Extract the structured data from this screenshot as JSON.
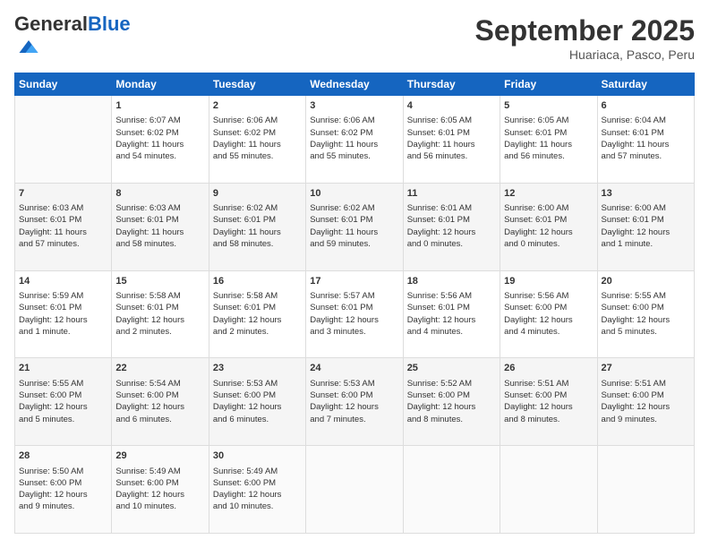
{
  "header": {
    "logo_general": "General",
    "logo_blue": "Blue",
    "month_title": "September 2025",
    "subtitle": "Huariaca, Pasco, Peru"
  },
  "days_of_week": [
    "Sunday",
    "Monday",
    "Tuesday",
    "Wednesday",
    "Thursday",
    "Friday",
    "Saturday"
  ],
  "weeks": [
    [
      {
        "day": "",
        "content": ""
      },
      {
        "day": "1",
        "content": "Sunrise: 6:07 AM\nSunset: 6:02 PM\nDaylight: 11 hours\nand 54 minutes."
      },
      {
        "day": "2",
        "content": "Sunrise: 6:06 AM\nSunset: 6:02 PM\nDaylight: 11 hours\nand 55 minutes."
      },
      {
        "day": "3",
        "content": "Sunrise: 6:06 AM\nSunset: 6:02 PM\nDaylight: 11 hours\nand 55 minutes."
      },
      {
        "day": "4",
        "content": "Sunrise: 6:05 AM\nSunset: 6:01 PM\nDaylight: 11 hours\nand 56 minutes."
      },
      {
        "day": "5",
        "content": "Sunrise: 6:05 AM\nSunset: 6:01 PM\nDaylight: 11 hours\nand 56 minutes."
      },
      {
        "day": "6",
        "content": "Sunrise: 6:04 AM\nSunset: 6:01 PM\nDaylight: 11 hours\nand 57 minutes."
      }
    ],
    [
      {
        "day": "7",
        "content": "Sunrise: 6:03 AM\nSunset: 6:01 PM\nDaylight: 11 hours\nand 57 minutes."
      },
      {
        "day": "8",
        "content": "Sunrise: 6:03 AM\nSunset: 6:01 PM\nDaylight: 11 hours\nand 58 minutes."
      },
      {
        "day": "9",
        "content": "Sunrise: 6:02 AM\nSunset: 6:01 PM\nDaylight: 11 hours\nand 58 minutes."
      },
      {
        "day": "10",
        "content": "Sunrise: 6:02 AM\nSunset: 6:01 PM\nDaylight: 11 hours\nand 59 minutes."
      },
      {
        "day": "11",
        "content": "Sunrise: 6:01 AM\nSunset: 6:01 PM\nDaylight: 12 hours\nand 0 minutes."
      },
      {
        "day": "12",
        "content": "Sunrise: 6:00 AM\nSunset: 6:01 PM\nDaylight: 12 hours\nand 0 minutes."
      },
      {
        "day": "13",
        "content": "Sunrise: 6:00 AM\nSunset: 6:01 PM\nDaylight: 12 hours\nand 1 minute."
      }
    ],
    [
      {
        "day": "14",
        "content": "Sunrise: 5:59 AM\nSunset: 6:01 PM\nDaylight: 12 hours\nand 1 minute."
      },
      {
        "day": "15",
        "content": "Sunrise: 5:58 AM\nSunset: 6:01 PM\nDaylight: 12 hours\nand 2 minutes."
      },
      {
        "day": "16",
        "content": "Sunrise: 5:58 AM\nSunset: 6:01 PM\nDaylight: 12 hours\nand 2 minutes."
      },
      {
        "day": "17",
        "content": "Sunrise: 5:57 AM\nSunset: 6:01 PM\nDaylight: 12 hours\nand 3 minutes."
      },
      {
        "day": "18",
        "content": "Sunrise: 5:56 AM\nSunset: 6:01 PM\nDaylight: 12 hours\nand 4 minutes."
      },
      {
        "day": "19",
        "content": "Sunrise: 5:56 AM\nSunset: 6:00 PM\nDaylight: 12 hours\nand 4 minutes."
      },
      {
        "day": "20",
        "content": "Sunrise: 5:55 AM\nSunset: 6:00 PM\nDaylight: 12 hours\nand 5 minutes."
      }
    ],
    [
      {
        "day": "21",
        "content": "Sunrise: 5:55 AM\nSunset: 6:00 PM\nDaylight: 12 hours\nand 5 minutes."
      },
      {
        "day": "22",
        "content": "Sunrise: 5:54 AM\nSunset: 6:00 PM\nDaylight: 12 hours\nand 6 minutes."
      },
      {
        "day": "23",
        "content": "Sunrise: 5:53 AM\nSunset: 6:00 PM\nDaylight: 12 hours\nand 6 minutes."
      },
      {
        "day": "24",
        "content": "Sunrise: 5:53 AM\nSunset: 6:00 PM\nDaylight: 12 hours\nand 7 minutes."
      },
      {
        "day": "25",
        "content": "Sunrise: 5:52 AM\nSunset: 6:00 PM\nDaylight: 12 hours\nand 8 minutes."
      },
      {
        "day": "26",
        "content": "Sunrise: 5:51 AM\nSunset: 6:00 PM\nDaylight: 12 hours\nand 8 minutes."
      },
      {
        "day": "27",
        "content": "Sunrise: 5:51 AM\nSunset: 6:00 PM\nDaylight: 12 hours\nand 9 minutes."
      }
    ],
    [
      {
        "day": "28",
        "content": "Sunrise: 5:50 AM\nSunset: 6:00 PM\nDaylight: 12 hours\nand 9 minutes."
      },
      {
        "day": "29",
        "content": "Sunrise: 5:49 AM\nSunset: 6:00 PM\nDaylight: 12 hours\nand 10 minutes."
      },
      {
        "day": "30",
        "content": "Sunrise: 5:49 AM\nSunset: 6:00 PM\nDaylight: 12 hours\nand 10 minutes."
      },
      {
        "day": "",
        "content": ""
      },
      {
        "day": "",
        "content": ""
      },
      {
        "day": "",
        "content": ""
      },
      {
        "day": "",
        "content": ""
      }
    ]
  ]
}
